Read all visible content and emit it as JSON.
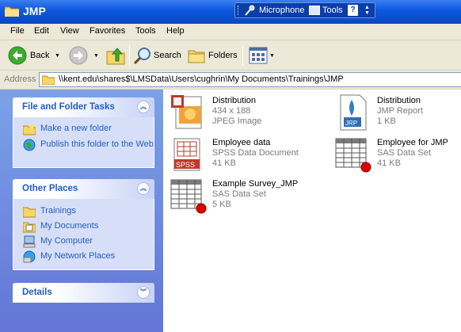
{
  "window": {
    "title": "JMP"
  },
  "language_bar": {
    "microphone": "Microphone",
    "tools": "Tools",
    "help": "?"
  },
  "menu": [
    "File",
    "Edit",
    "View",
    "Favorites",
    "Tools",
    "Help"
  ],
  "toolbar": {
    "back": "Back",
    "search": "Search",
    "folders": "Folders"
  },
  "address": {
    "label": "Address",
    "path": "\\\\kent.edu\\shares$\\LMSData\\Users\\cughrin\\My Documents\\Trainings\\JMP"
  },
  "tasks_panel": {
    "title": "File and Folder Tasks",
    "items": [
      "Make a new folder",
      "Publish this folder to the Web"
    ]
  },
  "places_panel": {
    "title": "Other Places",
    "items": [
      "Trainings",
      "My Documents",
      "My Computer",
      "My Network Places"
    ]
  },
  "details_panel": {
    "title": "Details"
  },
  "files": [
    {
      "name": "Distribution",
      "type": "434 x 188",
      "size": "JPEG Image",
      "icon": "jpeg-image-icon"
    },
    {
      "name": "Distribution",
      "type": "JMP Report",
      "size": "1 KB",
      "icon": "jmp-report-icon"
    },
    {
      "name": "Employee data",
      "type": "SPSS Data Document",
      "size": "41 KB",
      "icon": "spss-data-icon"
    },
    {
      "name": "Employee for JMP",
      "type": "SAS Data Set",
      "size": "41 KB",
      "icon": "sas-dataset-icon"
    },
    {
      "name": "Example Survey_JMP",
      "type": "SAS Data Set",
      "size": "5 KB",
      "icon": "sas-dataset-icon"
    }
  ],
  "colors": {
    "title_bar": "#0a4fd2",
    "task_pane": "#7ba2e7",
    "link": "#215dc6"
  }
}
